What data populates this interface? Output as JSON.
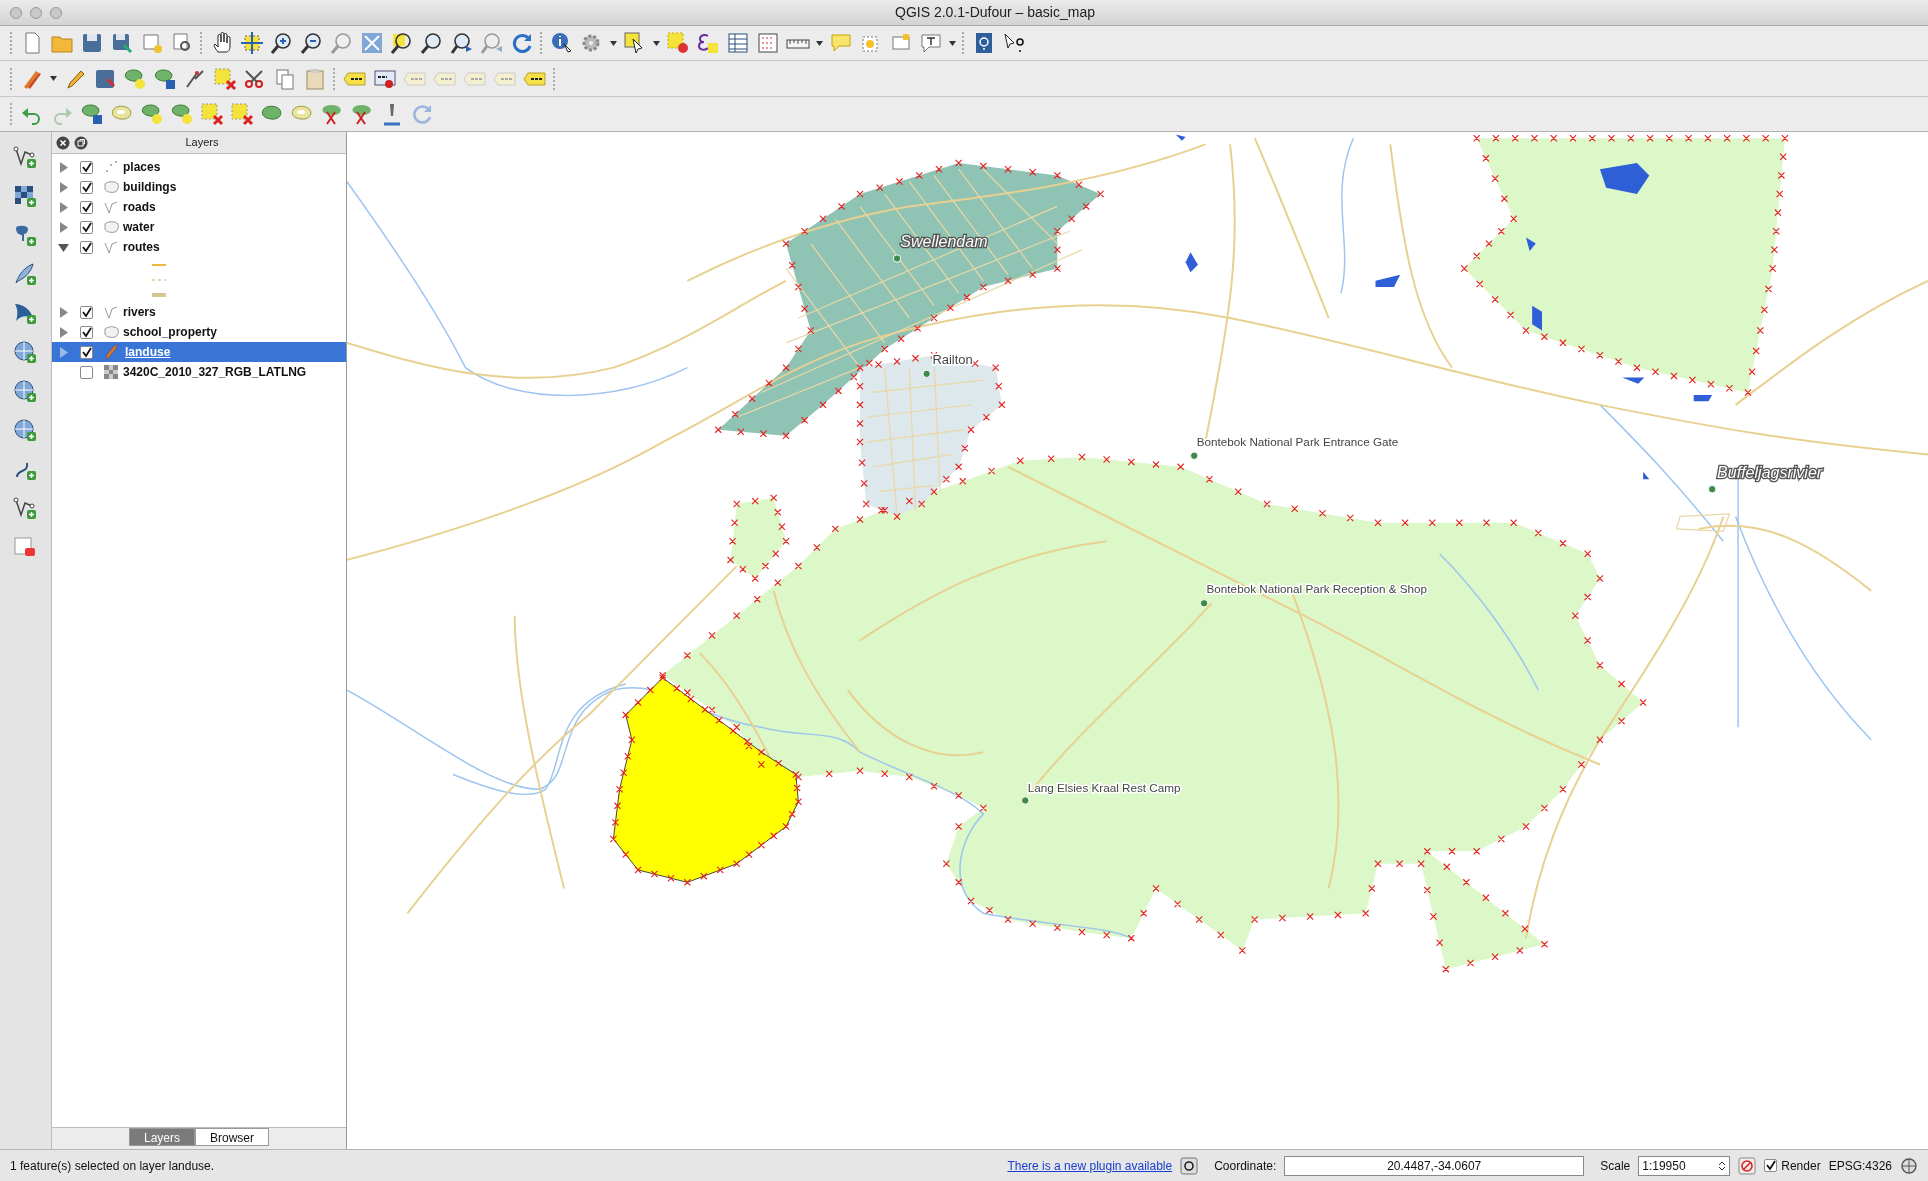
{
  "window": {
    "title": "QGIS 2.0.1-Dufour – basic_map"
  },
  "layers_panel": {
    "title": "Layers",
    "layers": [
      {
        "name": "places",
        "kind": "points",
        "checked": true,
        "expanded": false,
        "selected": false
      },
      {
        "name": "buildings",
        "kind": "polygon",
        "checked": true,
        "expanded": false,
        "selected": false
      },
      {
        "name": "roads",
        "kind": "line",
        "checked": true,
        "expanded": false,
        "selected": false
      },
      {
        "name": "water",
        "kind": "polygon",
        "checked": true,
        "expanded": false,
        "selected": false
      },
      {
        "name": "routes",
        "kind": "line",
        "checked": true,
        "expanded": true,
        "selected": false,
        "legend": [
          {
            "color": "#f2b640"
          },
          {
            "color": "#e6d6a8"
          },
          {
            "color": "#d9c58e"
          }
        ]
      },
      {
        "name": "rivers",
        "kind": "line",
        "checked": true,
        "expanded": false,
        "selected": false
      },
      {
        "name": "school_property",
        "kind": "polygon",
        "checked": true,
        "expanded": false,
        "selected": false
      },
      {
        "name": "landuse",
        "kind": "editing",
        "checked": true,
        "expanded": false,
        "selected": true
      },
      {
        "name": "3420C_2010_327_RGB_LATLNG",
        "kind": "raster",
        "checked": false,
        "selected": false
      }
    ],
    "tabs": [
      {
        "label": "Layers",
        "selected": true
      },
      {
        "label": "Browser",
        "selected": false
      }
    ]
  },
  "map": {
    "labels": [
      {
        "text": "Swellendam",
        "kind": "town"
      },
      {
        "text": "Railton",
        "kind": "suburb"
      },
      {
        "text": "Bontebok National Park Entrance Gate",
        "kind": "poi"
      },
      {
        "text": "Bontebok National Park Reception & Shop",
        "kind": "poi"
      },
      {
        "text": "Lang Elsies Kraal Rest Camp",
        "kind": "poi"
      },
      {
        "text": "Buffeljagsrivier",
        "kind": "town"
      }
    ]
  },
  "status_bar": {
    "message": "1 feature(s) selected on layer landuse.",
    "plugin_link": "There is a new plugin available",
    "coordinate_label": "Coordinate:",
    "coordinate": "20.4487,-34.0607",
    "scale_label": "Scale",
    "scale": "1:19950",
    "render": {
      "label": "Render",
      "checked": true
    },
    "crs": "EPSG:4326"
  }
}
